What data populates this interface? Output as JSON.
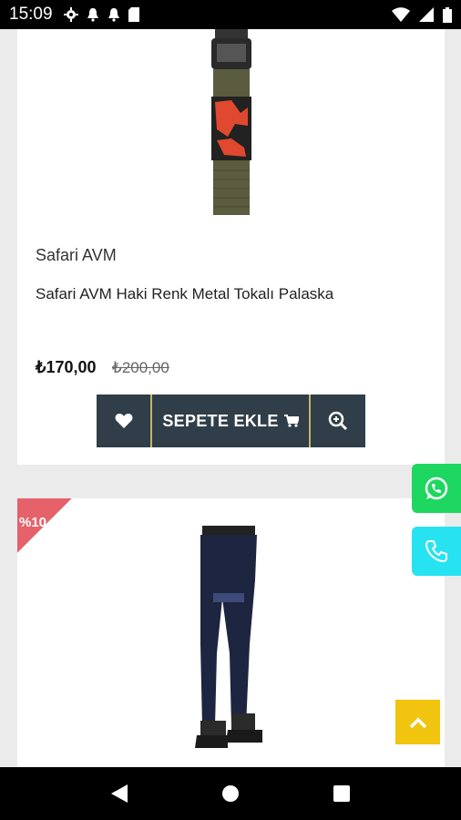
{
  "status_bar": {
    "time": "15:09",
    "icons_left": [
      "gear-icon",
      "bell-icon",
      "bell-icon",
      "sim-card-icon"
    ],
    "icons_right": [
      "wifi-icon",
      "signal-icon",
      "battery-icon"
    ]
  },
  "product1": {
    "brand": "Safari AVM",
    "title": "Safari AVM Haki Renk Metal Tokalı Palaska",
    "price_new": "₺170,00",
    "price_old": "₺200,00",
    "cart_label": "SEPETE EKLE"
  },
  "product2": {
    "discount_label": "%10"
  },
  "colors": {
    "button_bg": "#2f3e48",
    "whatsapp": "#1ed760",
    "phone": "#27e2f0",
    "scroll_top": "#f1c40f",
    "discount": "#e5626a"
  }
}
